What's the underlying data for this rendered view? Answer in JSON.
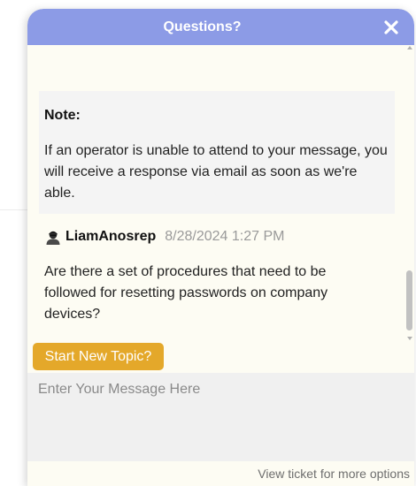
{
  "header": {
    "title": "Questions?",
    "close_icon": "close-icon"
  },
  "note": {
    "title": "Note:",
    "text": "If an operator is unable to attend to your message, you will receive a response via email as soon as we're able."
  },
  "message": {
    "user": "LiamAnosrep",
    "timestamp": "8/28/2024 1:27 PM",
    "text": "Are there a set of procedures that need to be followed for resetting passwords on company devices?",
    "user_icon": "user-icon"
  },
  "actions": {
    "new_topic_label": "Start New Topic?"
  },
  "input": {
    "placeholder": "Enter Your Message Here",
    "value": ""
  },
  "footer": {
    "view_ticket_label": "View ticket for more options"
  },
  "colors": {
    "header": "#8c9be6",
    "button": "#e4a82a",
    "panel": "#fdfcf3",
    "note_box": "#f4f4f4",
    "input": "#f0f0f0"
  }
}
